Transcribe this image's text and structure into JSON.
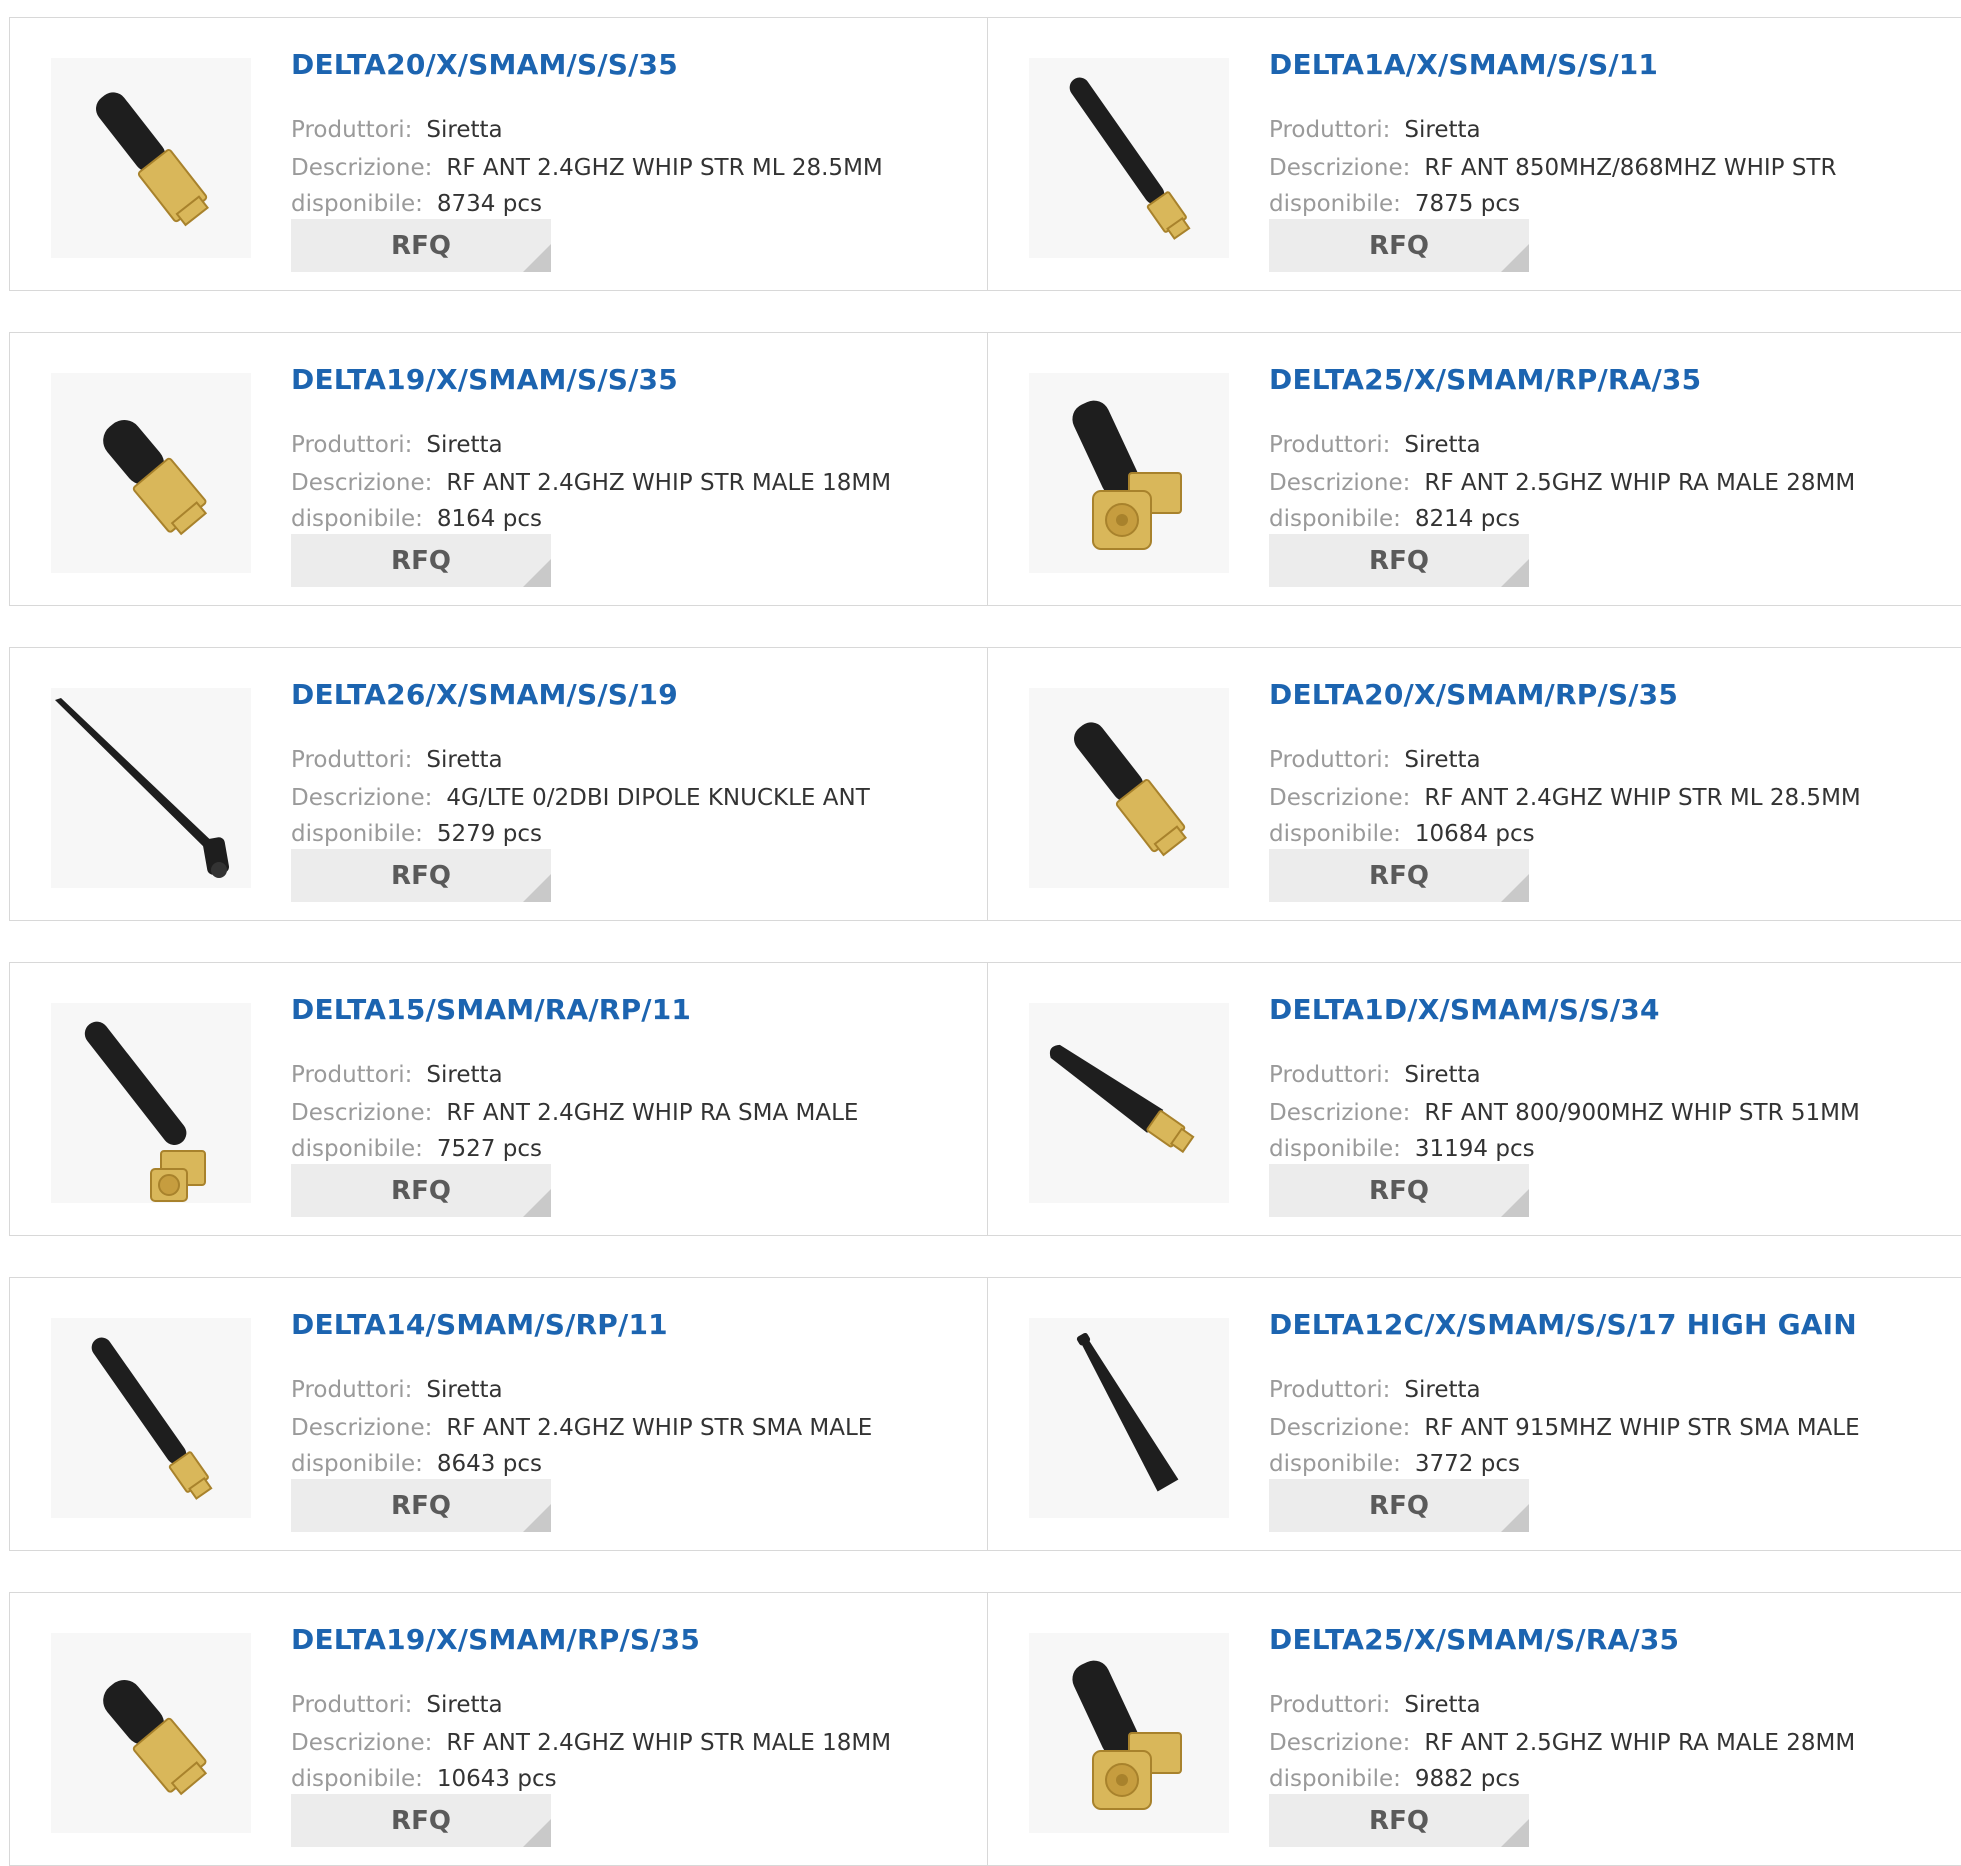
{
  "labels": {
    "manufacturer": "Produttori:",
    "description": "Descrizione:",
    "available": "disponibile:",
    "rfq": "RFQ"
  },
  "products": [
    {
      "title": "DELTA20/X/SMAM/S/S/35",
      "manufacturer": "Siretta",
      "description": "RF ANT 2.4GHZ WHIP STR ML 28.5MM",
      "available": "8734 pcs",
      "image": "stubby-antenna-straight"
    },
    {
      "title": "DELTA1A/X/SMAM/S/S/11",
      "manufacturer": "Siretta",
      "description": "RF ANT 850MHZ/868MHZ WHIP STR",
      "available": "7875 pcs",
      "image": "whip-antenna-straight"
    },
    {
      "title": "DELTA19/X/SMAM/S/S/35",
      "manufacturer": "Siretta",
      "description": "RF ANT 2.4GHZ WHIP STR MALE 18MM",
      "available": "8164 pcs",
      "image": "stubby-antenna-short"
    },
    {
      "title": "DELTA25/X/SMAM/RP/RA/35",
      "manufacturer": "Siretta",
      "description": "RF ANT 2.5GHZ WHIP RA MALE 28MM",
      "available": "8214 pcs",
      "image": "stubby-antenna-right-angle"
    },
    {
      "title": "DELTA26/X/SMAM/S/S/19",
      "manufacturer": "Siretta",
      "description": "4G/LTE 0/2DBI DIPOLE KNUCKLE ANT",
      "available": "5279 pcs",
      "image": "dipole-knuckle-antenna"
    },
    {
      "title": "DELTA20/X/SMAM/RP/S/35",
      "manufacturer": "Siretta",
      "description": "RF ANT 2.4GHZ WHIP STR ML 28.5MM",
      "available": "10684 pcs",
      "image": "stubby-antenna-straight"
    },
    {
      "title": "DELTA15/SMAM/RA/RP/11",
      "manufacturer": "Siretta",
      "description": "RF ANT 2.4GHZ WHIP RA SMA MALE",
      "available": "7527 pcs",
      "image": "whip-antenna-right-angle"
    },
    {
      "title": "DELTA1D/X/SMAM/S/S/34",
      "manufacturer": "Siretta",
      "description": "RF ANT 800/900MHZ WHIP STR 51MM",
      "available": "31194 pcs",
      "image": "tapered-whip-antenna"
    },
    {
      "title": "DELTA14/SMAM/S/RP/11",
      "manufacturer": "Siretta",
      "description": "RF ANT 2.4GHZ WHIP STR SMA MALE",
      "available": "8643 pcs",
      "image": "whip-antenna-straight"
    },
    {
      "title": "DELTA12C/X/SMAM/S/S/17 HIGH GAIN",
      "manufacturer": "Siretta",
      "description": "RF ANT 915MHZ WHIP STR SMA MALE",
      "available": "3772 pcs",
      "image": "thin-whip-antenna"
    },
    {
      "title": "DELTA19/X/SMAM/RP/S/35",
      "manufacturer": "Siretta",
      "description": "RF ANT 2.4GHZ WHIP STR MALE 18MM",
      "available": "10643 pcs",
      "image": "stubby-antenna-short"
    },
    {
      "title": "DELTA25/X/SMAM/S/RA/35",
      "manufacturer": "Siretta",
      "description": "RF ANT 2.5GHZ WHIP RA MALE 28MM",
      "available": "9882 pcs",
      "image": "stubby-antenna-right-angle"
    }
  ],
  "colors": {
    "title": "#1c64b0",
    "label": "#9a9a9a",
    "value": "#333333",
    "button_bg": "#ececec",
    "border": "#d8d8d8",
    "antenna_body": "#1e1e1e",
    "connector_gold": "#d9b75a"
  }
}
